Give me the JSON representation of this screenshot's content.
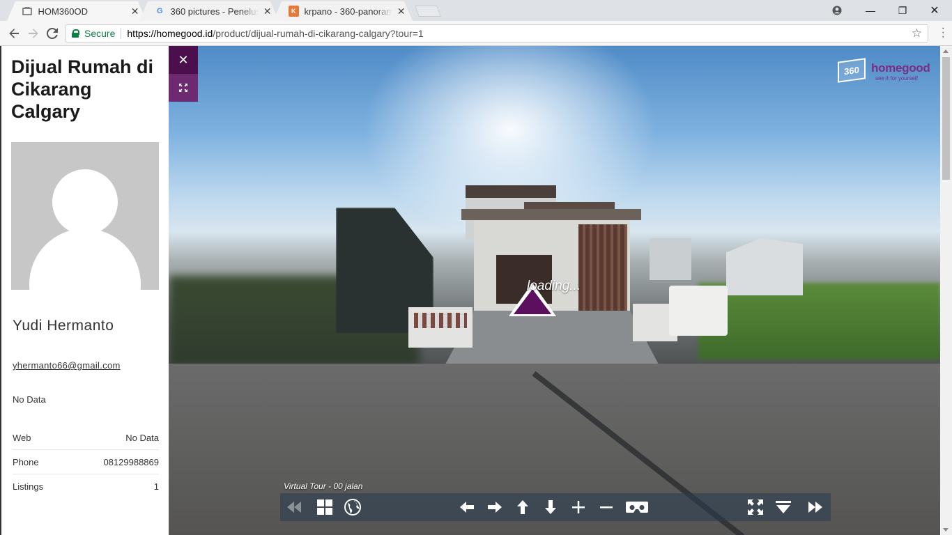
{
  "browser": {
    "tabs": [
      {
        "title": "HOM360OD",
        "icon": "page-icon"
      },
      {
        "title": "360 pictures - Penelusuran",
        "icon": "google-icon"
      },
      {
        "title": "krpano - 360-panorama-",
        "icon": "krpano-icon"
      }
    ],
    "secure_label": "Secure",
    "url_host": "https://homegood.id",
    "url_path": "/product/dijual-rumah-di-cikarang-calgary?tour=1"
  },
  "listing": {
    "title": "Dijual Rumah di Cikarang Calgary"
  },
  "agent": {
    "name": "Yudi Hermanto",
    "email": "yhermanto66@gmail.com",
    "nodata": "No Data",
    "rows": [
      {
        "label": "Web",
        "value": "No Data"
      },
      {
        "label": "Phone",
        "value": "08129988869"
      },
      {
        "label": "Listings",
        "value": "1"
      }
    ]
  },
  "viewer": {
    "logo_mark": "360",
    "logo_brand": "homegood",
    "logo_tagline": "see it for yourself",
    "loading_text": "loading...",
    "tour_caption": "Virtual Tour - 00 jalan",
    "accent_color": "#5b0f5e"
  }
}
